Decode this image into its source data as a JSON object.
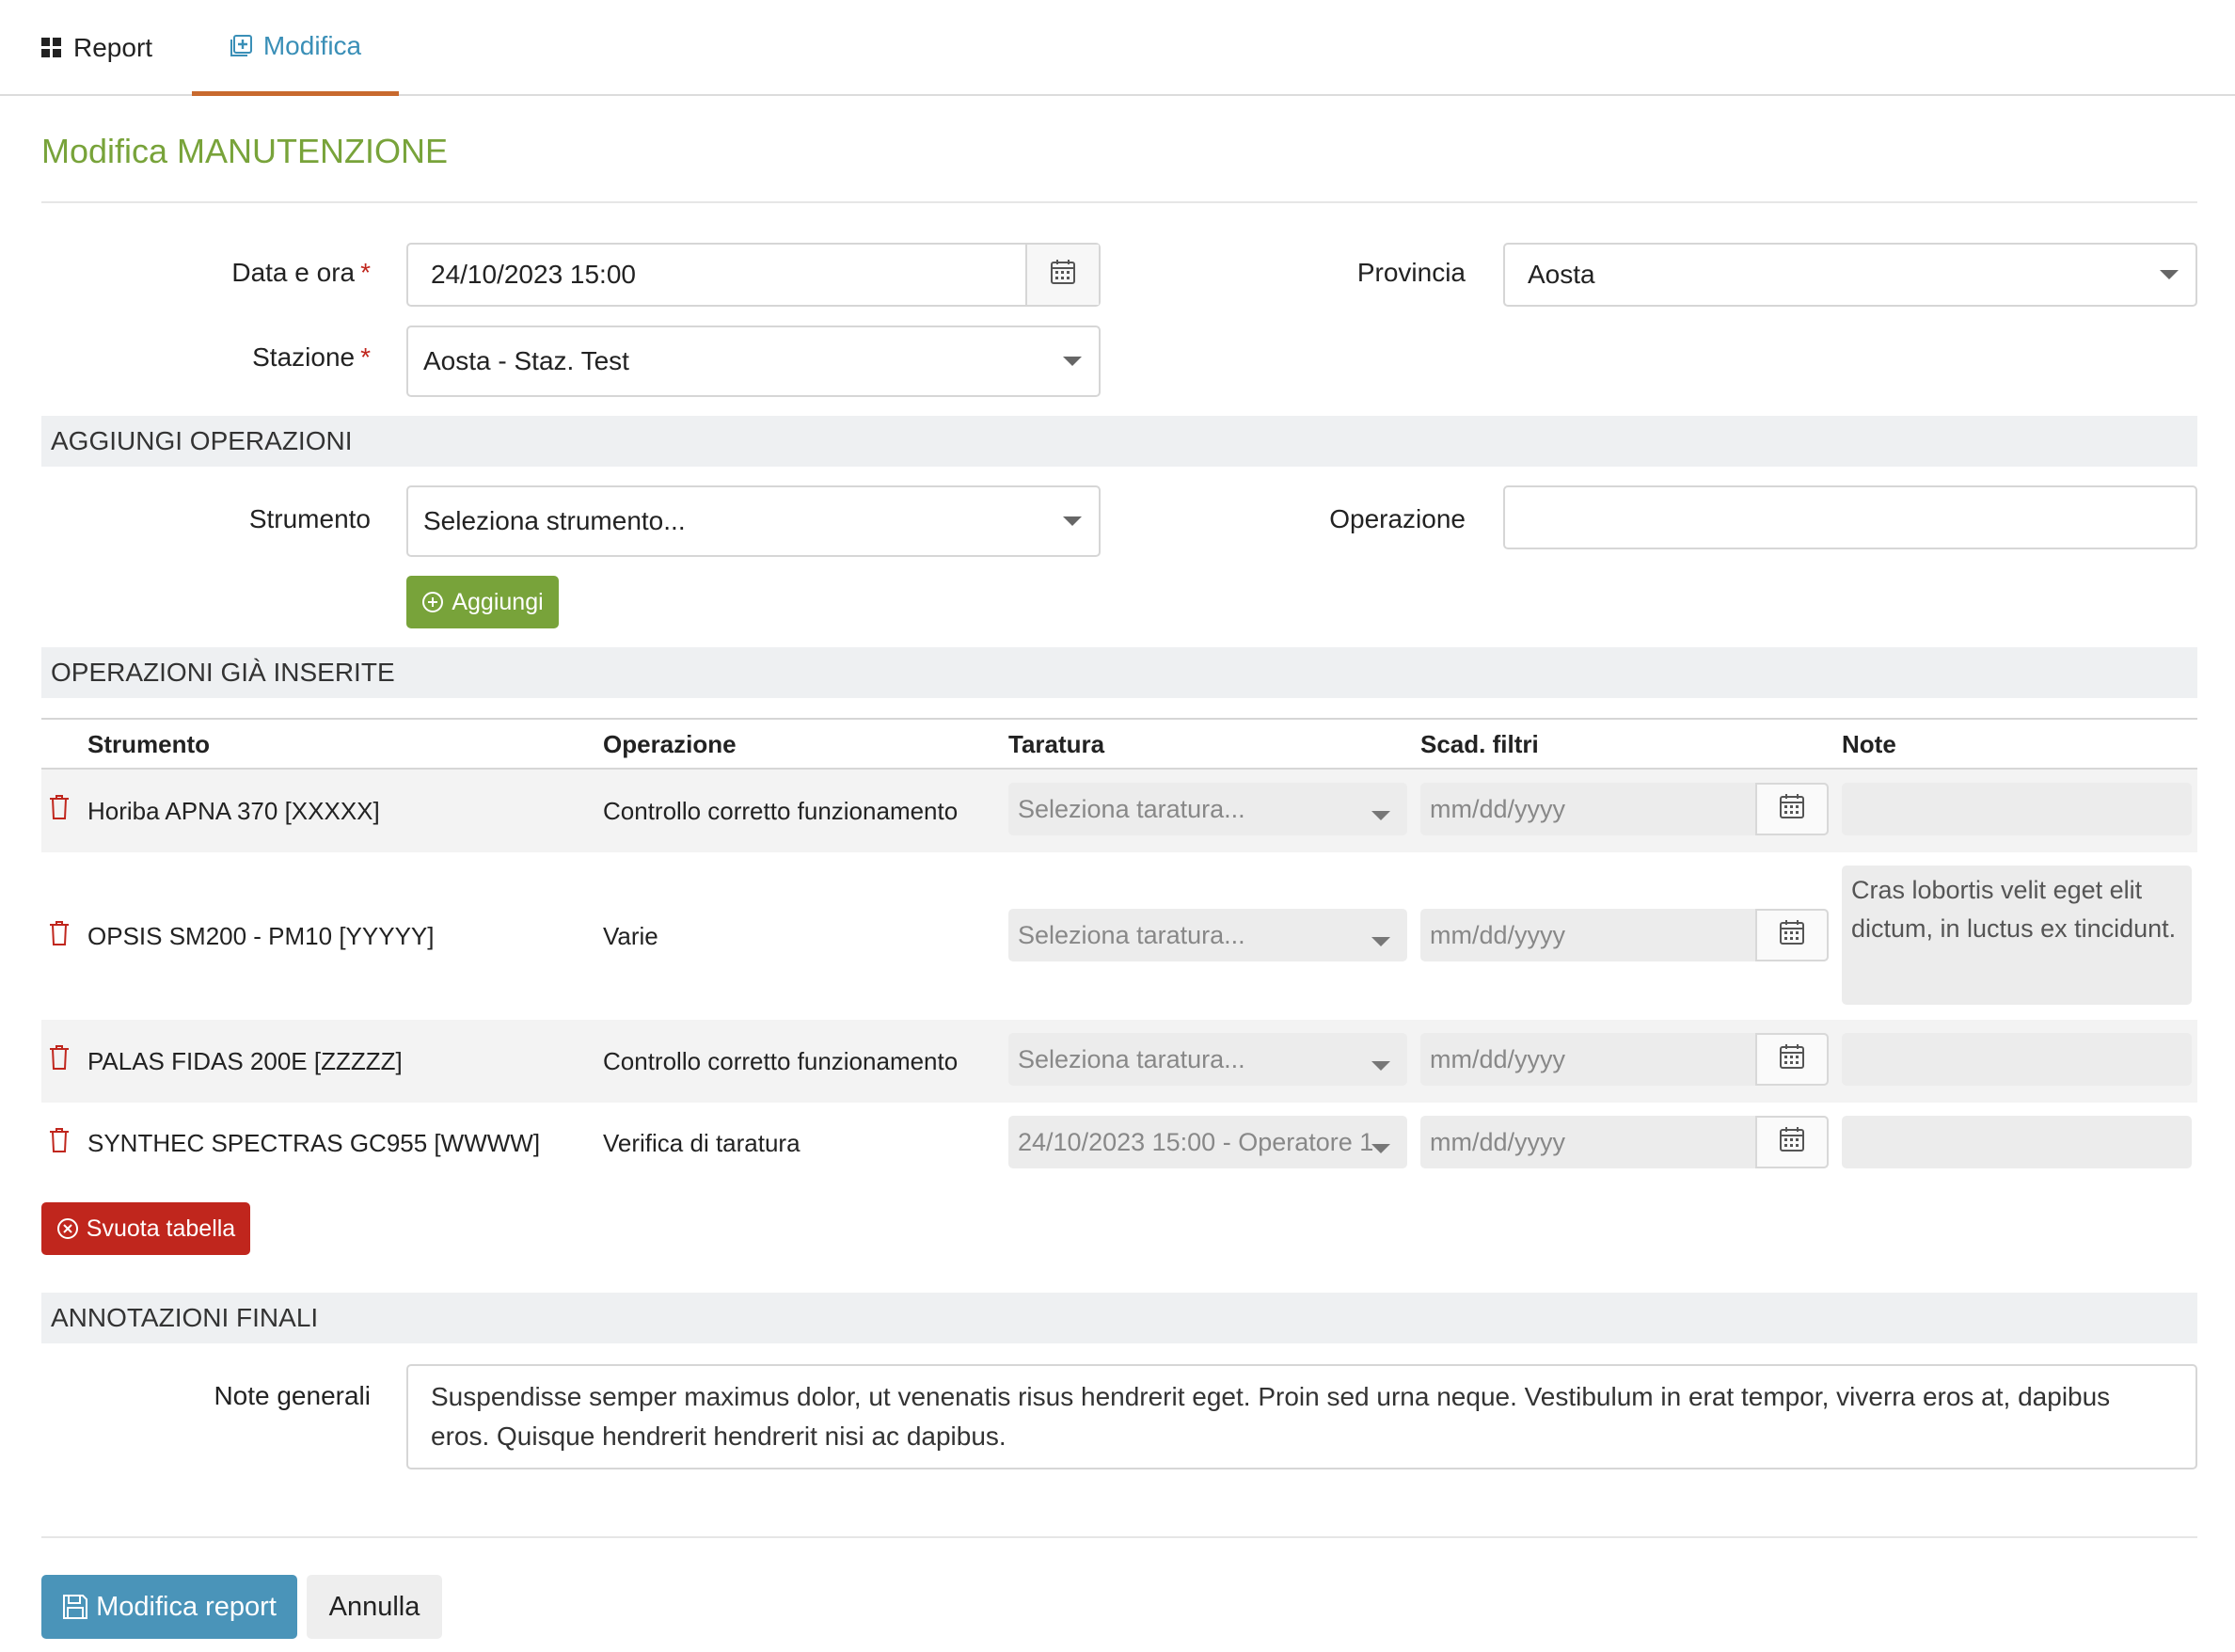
{
  "tabs": [
    {
      "label": "Report",
      "icon": "grid-icon"
    },
    {
      "label": "Modifica",
      "icon": "plus-square-icon"
    }
  ],
  "page_title": "Modifica MANUTENZIONE",
  "form": {
    "data_ora_label": "Data e ora",
    "data_ora_value": "24/10/2023 15:00",
    "provincia_label": "Provincia",
    "provincia_value": "Aosta",
    "stazione_label": "Stazione",
    "stazione_value": "Aosta - Staz. Test",
    "required_mark": "*"
  },
  "sections": {
    "aggiungi": "AGGIUNGI OPERAZIONI",
    "inserite": "OPERAZIONI GIÀ INSERITE",
    "annotazioni": "ANNOTAZIONI FINALI"
  },
  "aggiungi": {
    "strumento_label": "Strumento",
    "strumento_value": "Seleziona strumento...",
    "operazione_label": "Operazione",
    "operazione_value": "",
    "add_button": "Aggiungi"
  },
  "table": {
    "headers": [
      "Strumento",
      "Operazione",
      "Taratura",
      "Scad. filtri",
      "Note"
    ],
    "rows": [
      {
        "strumento": "Horiba APNA 370 [XXXXX]",
        "operazione": "Controllo corretto funzionamento",
        "taratura": "Seleziona taratura...",
        "scad": "mm/dd/yyyy",
        "note": ""
      },
      {
        "strumento": "OPSIS SM200 - PM10 [YYYYY]",
        "operazione": "Varie",
        "taratura": "Seleziona taratura...",
        "scad": "mm/dd/yyyy",
        "note": "Cras lobortis velit eget elit dictum, in luctus ex tincidunt."
      },
      {
        "strumento": "PALAS FIDAS 200E [ZZZZZ]",
        "operazione": "Controllo corretto funzionamento",
        "taratura": "Seleziona taratura...",
        "scad": "mm/dd/yyyy",
        "note": ""
      },
      {
        "strumento": "SYNTHEC SPECTRAS GC955 [WWWW]",
        "operazione": "Verifica di taratura",
        "taratura": "24/10/2023 15:00 - Operatore 1",
        "scad": "mm/dd/yyyy",
        "note": ""
      }
    ],
    "clear_button": "Svuota tabella"
  },
  "annotazioni": {
    "note_label": "Note generali",
    "note_value": "Suspendisse semper maximus dolor, ut venenatis risus hendrerit eget. Proin sed urna neque. Vestibulum in erat tempor, viverra eros at, dapibus eros.  Quisque hendrerit hendrerit nisi ac dapibus."
  },
  "footer": {
    "save_button": "Modifica report",
    "cancel_button": "Annulla"
  },
  "colors": {
    "accent_green": "#78a33a",
    "tab_blue": "#3a8fb7",
    "tab_underline": "#c8692e",
    "danger": "#c0261d",
    "primary": "#4a94b9"
  }
}
